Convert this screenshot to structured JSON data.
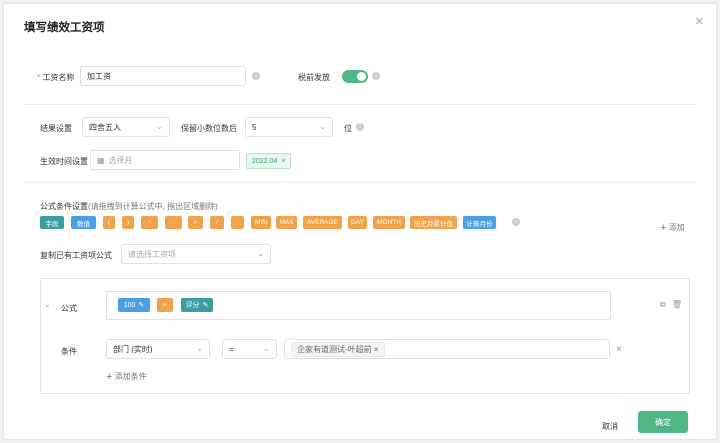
{
  "dialog": {
    "title": "填写绩效工资项"
  },
  "name_field": {
    "label": "工资名称",
    "value": "加工资"
  },
  "pretax": {
    "label": "税前发放",
    "on": true
  },
  "result": {
    "label": "结果设置",
    "rounding_value": "四舍五入",
    "decimal_label": "保留小数位数后",
    "decimal_value": "5",
    "unit": "位"
  },
  "effective": {
    "label": "生效时间设置",
    "placeholder": "选择月",
    "tag": "2022.04"
  },
  "formula_settings": {
    "label": "公式条件设置",
    "hint": "(请拖拽到计算公式中, 拖出区域删除)",
    "chips": [
      {
        "text": "字段",
        "color": "#3c9ea0"
      },
      {
        "text": "数值",
        "color": "#4a9fe6"
      },
      {
        "text": "(",
        "color": "#f0a34b"
      },
      {
        "text": ")",
        "color": "#f0a34b"
      },
      {
        "text": "+",
        "color": "#f0a34b"
      },
      {
        "text": "-",
        "color": "#f0a34b"
      },
      {
        "text": "×",
        "color": "#f0a34b"
      },
      {
        "text": "/",
        "color": "#f0a34b"
      },
      {
        "text": ",",
        "color": "#f0a34b"
      },
      {
        "text": "MIN",
        "color": "#f0a34b"
      },
      {
        "text": "MAX",
        "color": "#f0a34b"
      },
      {
        "text": "AVERAGE",
        "color": "#f0a34b"
      },
      {
        "text": "DAY",
        "color": "#f0a34b"
      },
      {
        "text": "MONTH",
        "color": "#f0a34b"
      },
      {
        "text": "历史月累计值",
        "color": "#f0a34b"
      },
      {
        "text": "计算月份",
        "color": "#4a9fe6"
      }
    ],
    "add_label": "添加"
  },
  "copy_formula": {
    "label": "复制已有工资项公式",
    "placeholder": "请选择工资项"
  },
  "rule": {
    "formula_label": "公式",
    "formula_items": {
      "value": "100",
      "op": "×",
      "field": "评分"
    },
    "condition_label": "条件",
    "condition_field": "部门 (实时)",
    "condition_op": "=",
    "condition_value": "企家有道测试-叶超前",
    "add_condition": "添加条件"
  },
  "footer": {
    "cancel": "取消",
    "confirm": "确定"
  }
}
